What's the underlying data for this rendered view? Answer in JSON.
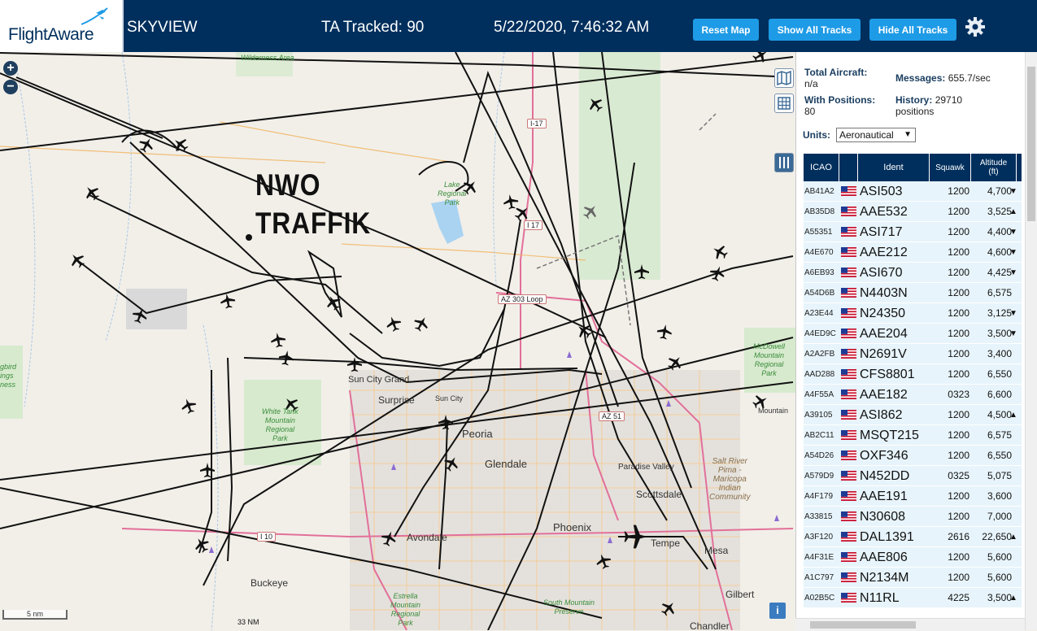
{
  "header": {
    "logo_text": "FlightAware",
    "app_name": "SKYVIEW",
    "tracked": "TA Tracked: 90",
    "datetime": "5/22/2020, 7:46:32 AM",
    "buttons": {
      "reset": "Reset Map",
      "show": "Show All Tracks",
      "hide": "Hide All Tracks"
    },
    "accent": "#1e9be6",
    "brand": "#002f5d",
    "settings_icon": "gear-icon"
  },
  "map": {
    "overlay_line1": "NWO",
    "overlay_line2": "TRAFFIK",
    "zoom_in": "+",
    "zoom_out": "−",
    "scale_text": "5 nm",
    "scale_secondary": "33 NM",
    "info": "i",
    "labels": {
      "wilderness": "Wilderness\nArea",
      "lake": "Lake\nRegional\nPark",
      "sun_city_grand": "Sun City Grand",
      "surprise": "Surprise",
      "sun_city": "Sun City",
      "peoria": "Peoria",
      "glendale": "Glendale",
      "paradise_valley": "Paradise Valley",
      "scottsdale": "Scottsdale",
      "phoenix": "Phoenix",
      "tempe": "Tempe",
      "mesa": "Mesa",
      "avondale": "Avondale",
      "buckeye": "Buckeye",
      "gilbert": "Gilbert",
      "chandler": "Chandler",
      "mountain": "Mountain",
      "white_tank": "White Tank\nMountain\nRegional\nPark",
      "mcdowell": "McDowell\nMountain\nRegional\nPark",
      "salt_river": "Salt River\nPima -\nMaricopa\nIndian\nCommunity",
      "estrella": "Estrella\nMountain\nRegional\nPark",
      "south_mountain": "South Mountain\nPreserve",
      "left_park": "gbird\nings\nness"
    },
    "roads": {
      "i17": "I-17",
      "i17b": "I 17",
      "az303": "AZ 303 Loop",
      "az51": "AZ 51",
      "i10": "I 10"
    }
  },
  "panel": {
    "total_aircraft_label": "Total Aircraft:",
    "total_aircraft_value": "n/a",
    "with_positions_label": "With Positions:",
    "with_positions_value": "80",
    "messages_label": "Messages:",
    "messages_value": "655.7/sec",
    "history_label": "History:",
    "history_value": "29710",
    "history_unit": "positions",
    "units_label": "Units:",
    "units_value": "Aeronautical",
    "columns": [
      "ICAO",
      "",
      "Ident",
      "Squawk",
      "Altitude\n(ft)"
    ],
    "rows": [
      {
        "icao": "AB41A2",
        "ident": "ASI503",
        "squawk": "1200",
        "alt": "4,700",
        "trend": "▼"
      },
      {
        "icao": "AB35D8",
        "ident": "AAE532",
        "squawk": "1200",
        "alt": "3,525",
        "trend": "▲"
      },
      {
        "icao": "A55351",
        "ident": "ASI717",
        "squawk": "1200",
        "alt": "4,400",
        "trend": "▼"
      },
      {
        "icao": "A4E670",
        "ident": "AAE212",
        "squawk": "1200",
        "alt": "4,600",
        "trend": "▼"
      },
      {
        "icao": "A6EB93",
        "ident": "ASI670",
        "squawk": "1200",
        "alt": "4,425",
        "trend": "▼"
      },
      {
        "icao": "A54D6B",
        "ident": "N4403N",
        "squawk": "1200",
        "alt": "6,575",
        "trend": ""
      },
      {
        "icao": "A23E44",
        "ident": "N24350",
        "squawk": "1200",
        "alt": "3,125",
        "trend": "▼"
      },
      {
        "icao": "A4ED9C",
        "ident": "AAE204",
        "squawk": "1200",
        "alt": "3,500",
        "trend": "▼"
      },
      {
        "icao": "A2A2FB",
        "ident": "N2691V",
        "squawk": "1200",
        "alt": "3,400",
        "trend": ""
      },
      {
        "icao": "AAD288",
        "ident": "CFS8801",
        "squawk": "1200",
        "alt": "6,550",
        "trend": ""
      },
      {
        "icao": "A4F55A",
        "ident": "AAE182",
        "squawk": "0323",
        "alt": "6,600",
        "trend": ""
      },
      {
        "icao": "A39105",
        "ident": "ASI862",
        "squawk": "1200",
        "alt": "4,500",
        "trend": "▲"
      },
      {
        "icao": "AB2C11",
        "ident": "MSQT215",
        "squawk": "1200",
        "alt": "6,575",
        "trend": ""
      },
      {
        "icao": "A54D26",
        "ident": "OXF346",
        "squawk": "1200",
        "alt": "6,550",
        "trend": ""
      },
      {
        "icao": "A579D9",
        "ident": "N452DD",
        "squawk": "0325",
        "alt": "5,075",
        "trend": ""
      },
      {
        "icao": "A4F179",
        "ident": "AAE191",
        "squawk": "1200",
        "alt": "3,600",
        "trend": ""
      },
      {
        "icao": "A33815",
        "ident": "N30608",
        "squawk": "1200",
        "alt": "7,000",
        "trend": ""
      },
      {
        "icao": "A3F120",
        "ident": "DAL1391",
        "squawk": "2616",
        "alt": "22,650",
        "trend": "▲"
      },
      {
        "icao": "A4F31E",
        "ident": "AAE806",
        "squawk": "1200",
        "alt": "5,600",
        "trend": ""
      },
      {
        "icao": "A1C797",
        "ident": "N2134M",
        "squawk": "1200",
        "alt": "5,600",
        "trend": ""
      },
      {
        "icao": "A02B5C",
        "ident": "N11RL",
        "squawk": "4225",
        "alt": "3,500",
        "trend": "▲"
      }
    ]
  }
}
